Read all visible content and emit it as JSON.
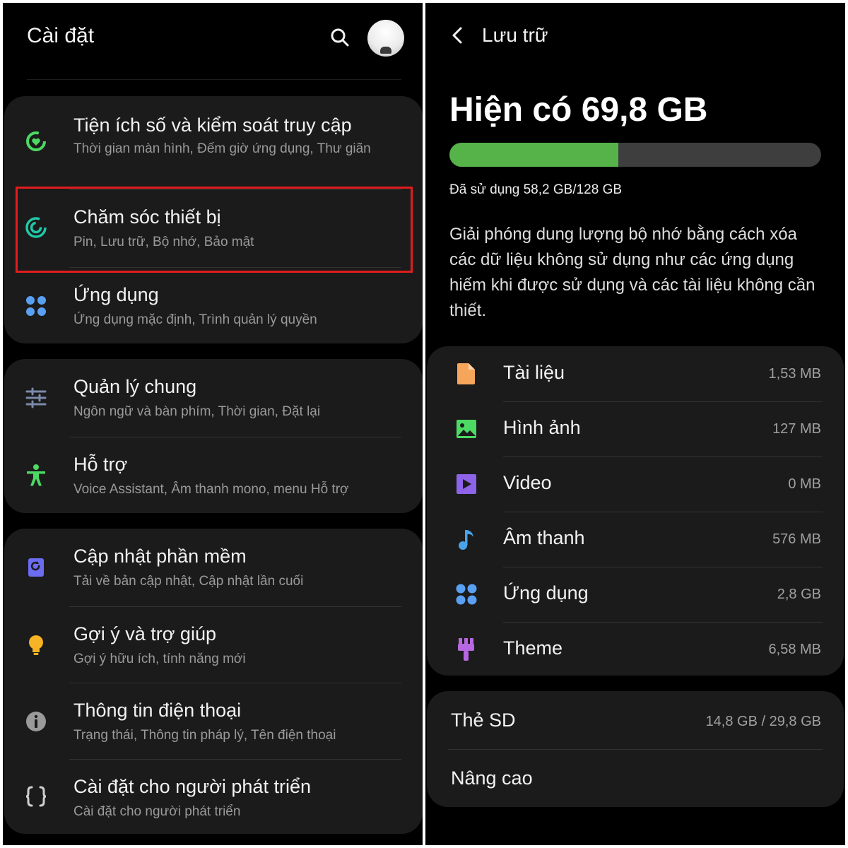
{
  "settings": {
    "title": "Cài đặt",
    "groups": [
      {
        "items": [
          {
            "title": "Tiện ích số và kiểm soát truy cập",
            "subtitle": "Thời gian màn hình, Đếm giờ ứng dụng, Thư giãn",
            "icon": "digital-wellbeing-icon",
            "color": "#4cd964"
          },
          {
            "title": "Chăm sóc thiết bị",
            "subtitle": "Pin, Lưu trữ, Bộ nhớ, Bảo mật",
            "icon": "device-care-icon",
            "color": "#1fc9a8"
          },
          {
            "title": "Ứng dụng",
            "subtitle": "Ứng dụng mặc định, Trình quản lý quyền",
            "icon": "apps-icon",
            "color": "#5aa0f2"
          }
        ]
      },
      {
        "items": [
          {
            "title": "Quản lý chung",
            "subtitle": "Ngôn ngữ và bàn phím, Thời gian, Đặt lại",
            "icon": "sliders-icon",
            "color": "#7b8aa8"
          },
          {
            "title": "Hỗ trợ",
            "subtitle": "Voice Assistant, Âm thanh mono, menu Hỗ trợ",
            "icon": "accessibility-icon",
            "color": "#4cd964"
          }
        ]
      },
      {
        "items": [
          {
            "title": "Cập nhật phần mềm",
            "subtitle": "Tải về bản cập nhật, Cập nhật lần cuối",
            "icon": "software-update-icon",
            "color": "#6b6cf0"
          },
          {
            "title": "Gợi ý và trợ giúp",
            "subtitle": "Gợi ý hữu ích, tính năng mới",
            "icon": "lightbulb-icon",
            "color": "#f5b325"
          },
          {
            "title": "Thông tin điện thoại",
            "subtitle": "Trạng thái, Thông tin pháp lý, Tên điện thoại",
            "icon": "info-icon",
            "color": "#9a9a9a"
          },
          {
            "title": "Cài đặt cho người phát triển",
            "subtitle": "Cài đặt cho người phát triển",
            "icon": "braces-icon",
            "color": "#cfcfcf"
          }
        ]
      }
    ]
  },
  "storage": {
    "title": "Lưu trữ",
    "available": "Hiện có 69,8 GB",
    "used_text": "Đã sử dụng 58,2 GB/128 GB",
    "used_fraction": 0.455,
    "bar_color": "#55b34a",
    "description": "Giải phóng dung lượng bộ nhớ bằng cách xóa các dữ liệu không sử dụng như các ứng dụng hiếm khi được sử dụng và các tài liệu không cần thiết.",
    "categories": [
      {
        "label": "Tài liệu",
        "value": "1,53 MB",
        "icon": "document-icon",
        "color": "#f5a65b"
      },
      {
        "label": "Hình ảnh",
        "value": "127 MB",
        "icon": "image-icon",
        "color": "#4cd964"
      },
      {
        "label": "Video",
        "value": "0 MB",
        "icon": "video-icon",
        "color": "#8d63e8"
      },
      {
        "label": "Âm thanh",
        "value": "576 MB",
        "icon": "music-icon",
        "color": "#4aa3e8"
      },
      {
        "label": "Ứng dụng",
        "value": "2,8 GB",
        "icon": "apps-icon",
        "color": "#5aa0f2"
      },
      {
        "label": "Theme",
        "value": "6,58 MB",
        "icon": "theme-brush-icon",
        "color": "#b768e0"
      }
    ],
    "sd": {
      "label": "Thẻ SD",
      "value": "14,8 GB / 29,8 GB"
    },
    "advanced": {
      "label": "Nâng cao"
    }
  }
}
